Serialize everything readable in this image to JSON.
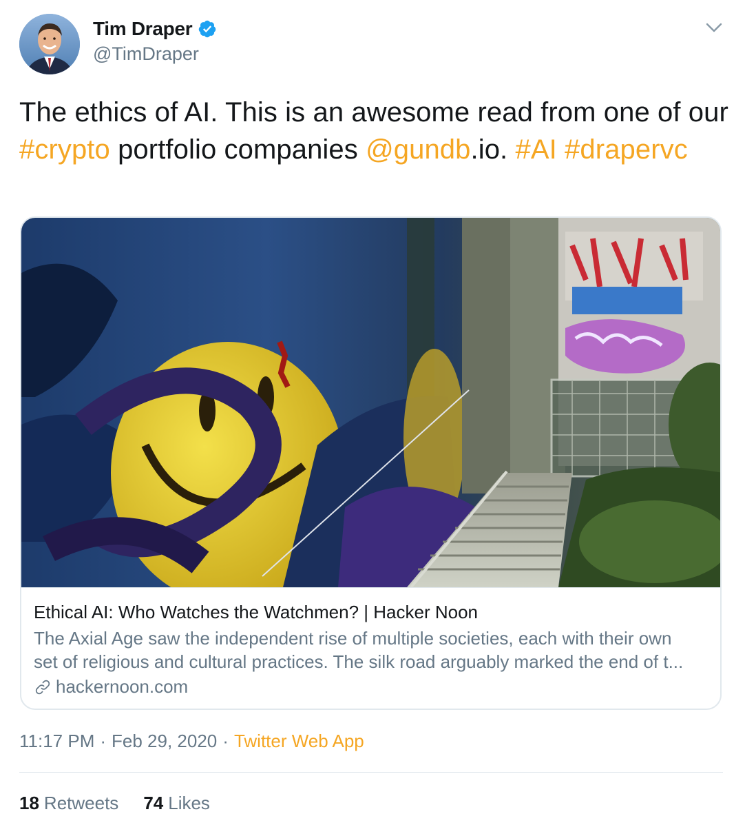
{
  "colors": {
    "accent": "#f5a623",
    "text_primary": "#14171a",
    "text_secondary": "#657786",
    "border": "#e1e8ed",
    "verified": "#1da1f2"
  },
  "author": {
    "name": "Tim Draper",
    "handle": "@TimDraper",
    "verified_icon": "verified-badge-icon",
    "avatar_icon": "avatar"
  },
  "menu_icon": "chevron-down-icon",
  "tweet": {
    "segments": {
      "t1": "The ethics of AI. This is an awesome read from one of our ",
      "h1": "#crypto",
      "t2": " portfolio companies ",
      "m1": "@gundb",
      "t3": ".io. ",
      "h2": "#AI",
      "t4": " ",
      "h3": "#drapervc"
    }
  },
  "card": {
    "title": "Ethical AI: Who Watches the Watchmen? | Hacker Noon",
    "description": "The Axial Age saw the independent rise of multiple societies, each with their own set of religious and cultural practices. The silk road arguably marked the end of t...",
    "domain": "hackernoon.com",
    "domain_icon": "link-icon"
  },
  "meta": {
    "time": "11:17 PM",
    "separator": "·",
    "date": "Feb 29, 2020",
    "source": "Twitter Web App"
  },
  "stats": {
    "retweets_count": "18",
    "retweets_label": "Retweets",
    "likes_count": "74",
    "likes_label": "Likes"
  }
}
